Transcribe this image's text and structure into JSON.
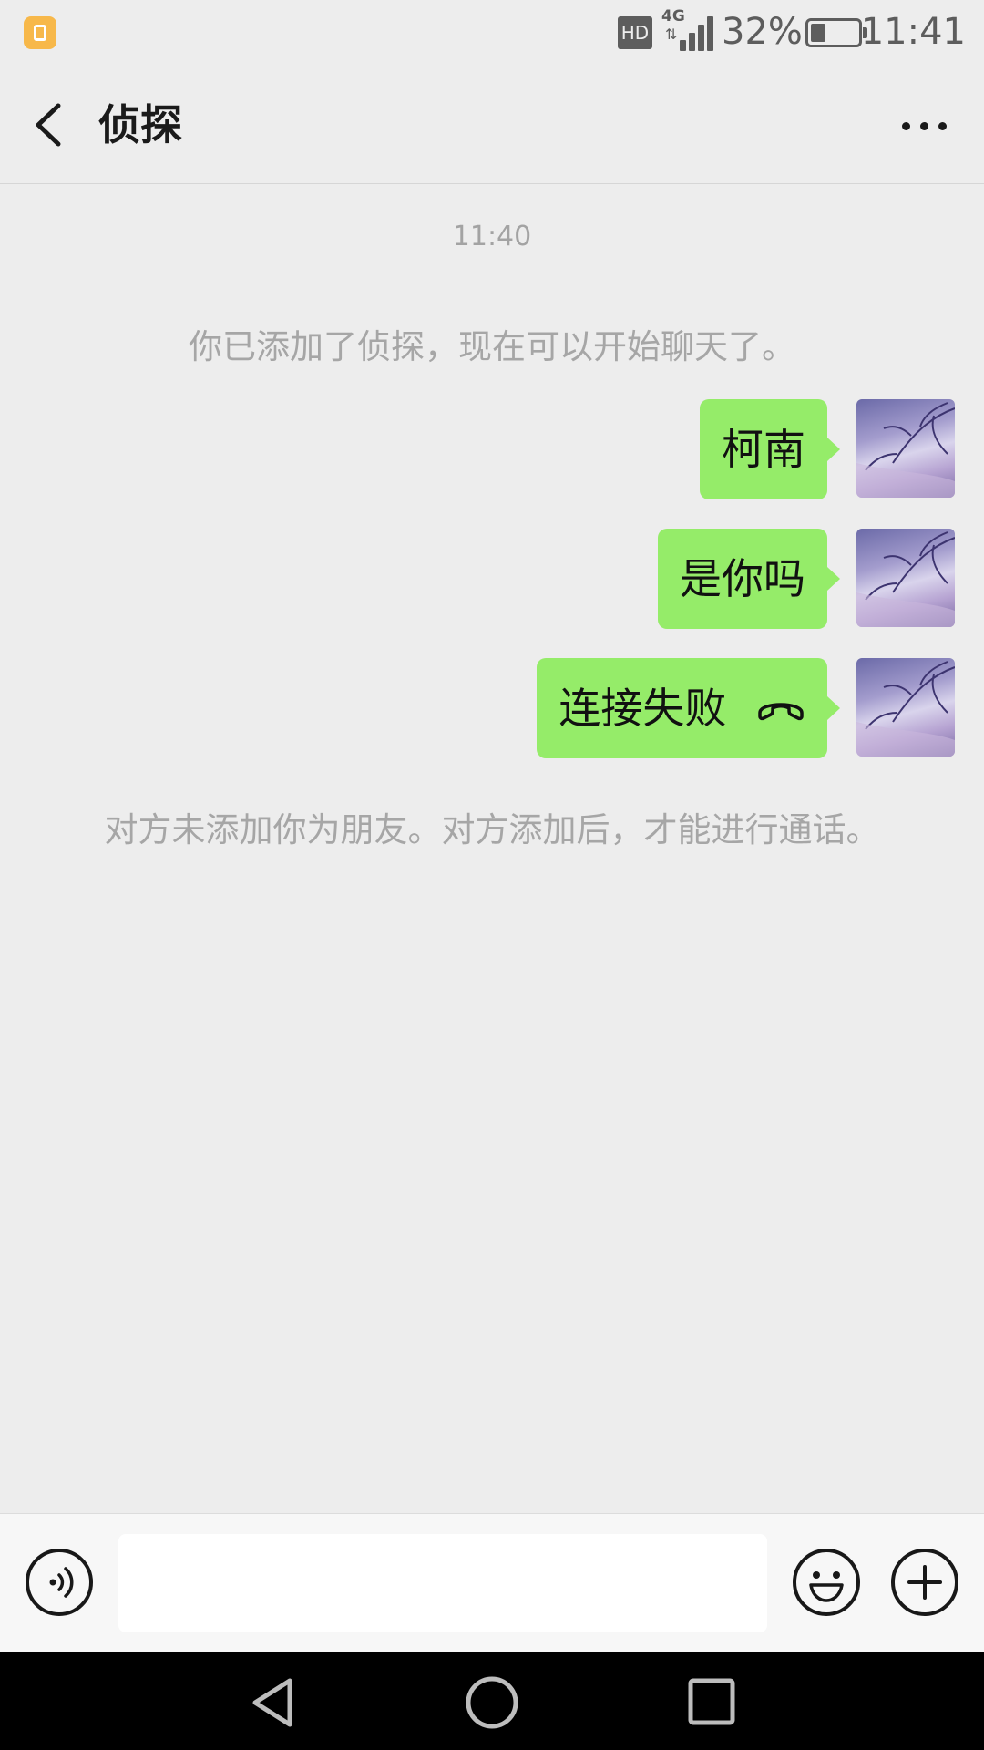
{
  "status_bar": {
    "hd_label": "HD",
    "network_label": "4G",
    "battery_percent": "32%",
    "battery_level": 0.32,
    "time": "11:41",
    "icons": [
      "notification-app-icon",
      "signal-icon",
      "battery-icon"
    ]
  },
  "header": {
    "title": "侦探",
    "back_icon": "chevron-left-icon",
    "more_icon": "more-dots-icon"
  },
  "chat": {
    "timestamp": "11:40",
    "system_added": "你已添加了侦探，现在可以开始聊天了。",
    "messages": [
      {
        "text": "柯南"
      },
      {
        "text": "是你吗"
      },
      {
        "text": "连接失败",
        "icon": "hangup-phone-icon"
      }
    ],
    "system_not_friend": "对方未添加你为朋友。对方添加后，才能进行通话。"
  },
  "input_bar": {
    "voice_icon": "voice-icon",
    "text_value": "",
    "emoji_icon": "emoji-icon",
    "add_icon": "plus-icon"
  },
  "nav_bar": {
    "icons": [
      "back-triangle-icon",
      "home-circle-icon",
      "recents-square-icon"
    ]
  },
  "colors": {
    "background": "#ededed",
    "bubble": "#95ec69",
    "system_text": "#a6a6a6"
  }
}
